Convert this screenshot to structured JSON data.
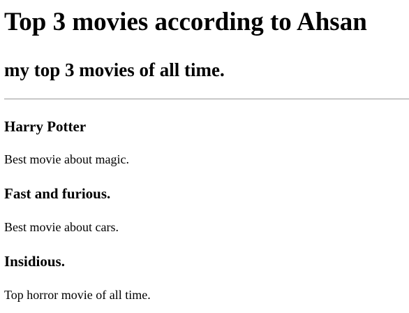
{
  "page": {
    "title": "Top 3 movies according to Ahsan",
    "subtitle": "my top 3 movies of all time."
  },
  "movies": [
    {
      "title": "Harry Potter",
      "description": "Best movie about magic."
    },
    {
      "title": "Fast and furious.",
      "description": "Best movie about cars."
    },
    {
      "title": "Insidious.",
      "description": "Top horror movie of all time."
    }
  ]
}
